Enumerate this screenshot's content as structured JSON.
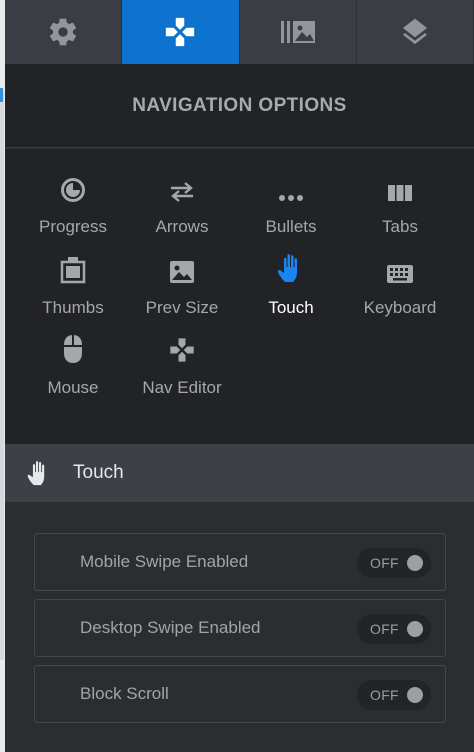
{
  "tabs": [
    {
      "icon": "gear-icon",
      "active": false
    },
    {
      "icon": "gamepad-icon",
      "active": true
    },
    {
      "icon": "media-library-icon",
      "active": false
    },
    {
      "icon": "layers-icon",
      "active": false
    }
  ],
  "header": {
    "title": "NAVIGATION OPTIONS"
  },
  "options": [
    {
      "label": "Progress",
      "icon": "progress-icon"
    },
    {
      "label": "Arrows",
      "icon": "arrows-icon"
    },
    {
      "label": "Bullets",
      "icon": "bullets-icon"
    },
    {
      "label": "Tabs",
      "icon": "tabs-icon"
    },
    {
      "label": "Thumbs",
      "icon": "thumbs-icon"
    },
    {
      "label": "Prev Size",
      "icon": "image-icon"
    },
    {
      "label": "Touch",
      "icon": "hand-icon",
      "active": true
    },
    {
      "label": "Keyboard",
      "icon": "keyboard-icon"
    },
    {
      "label": "Mouse",
      "icon": "mouse-icon"
    },
    {
      "label": "Nav Editor",
      "icon": "gamepad-icon"
    }
  ],
  "section": {
    "title": "Touch",
    "icon": "hand-icon"
  },
  "settings": [
    {
      "label": "Mobile Swipe Enabled",
      "value": "OFF"
    },
    {
      "label": "Desktop Swipe Enabled",
      "value": "OFF"
    },
    {
      "label": "Block Scroll",
      "value": "OFF"
    }
  ],
  "colors": {
    "accent": "#0e72cf",
    "active_icon": "#1a84f0",
    "panel": "#222327",
    "background": "#2b2d31"
  }
}
